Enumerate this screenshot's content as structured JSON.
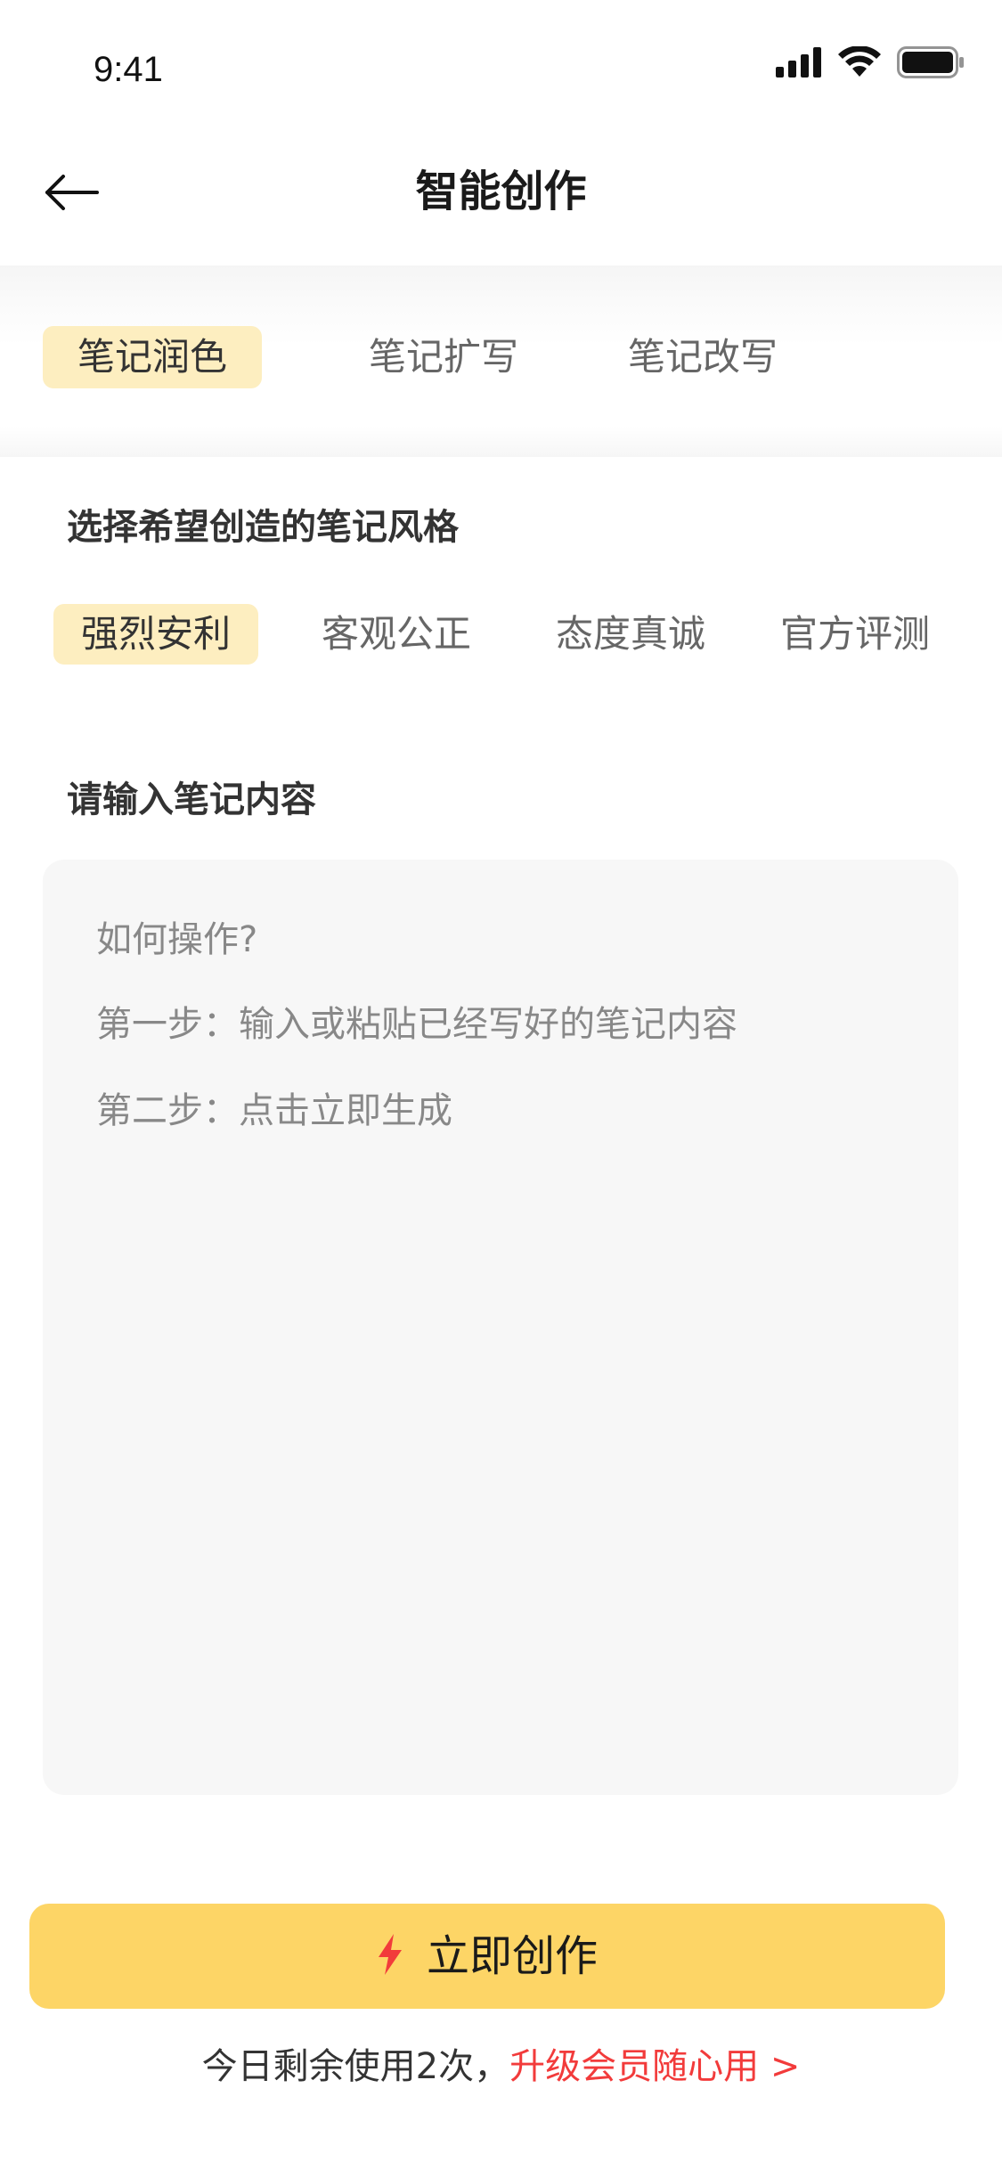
{
  "status_bar": {
    "time": "9:41",
    "icons": [
      "cellular-signal-icon",
      "wifi-icon",
      "battery-icon"
    ]
  },
  "header": {
    "title": "智能创作",
    "back_icon": "back-arrow-icon"
  },
  "mode_tabs": [
    {
      "label": "笔记润色",
      "active": true
    },
    {
      "label": "笔记扩写",
      "active": false
    },
    {
      "label": "笔记改写",
      "active": false
    }
  ],
  "style_section": {
    "label": "选择希望创造的笔记风格",
    "options": [
      {
        "label": "强烈安利",
        "active": true
      },
      {
        "label": "客观公正",
        "active": false
      },
      {
        "label": "态度真诚",
        "active": false
      },
      {
        "label": "官方评测",
        "active": false
      }
    ]
  },
  "content_section": {
    "label": "请输入笔记内容",
    "placeholder_lines": [
      "如何操作?",
      "第一步：输入或粘贴已经写好的笔记内容",
      "第二步：点击立即生成"
    ]
  },
  "create_button": {
    "label": "立即创作",
    "icon": "lightning-icon"
  },
  "quota": {
    "text": "今日剩余使用2次，",
    "link": "升级会员随心用 >"
  },
  "colors": {
    "accent": "#fdd566",
    "tab_active_bg": "#fdeec0",
    "link": "#f23b3b",
    "panel_bg": "#f7f7f7",
    "lightning": "#f23b3b"
  }
}
